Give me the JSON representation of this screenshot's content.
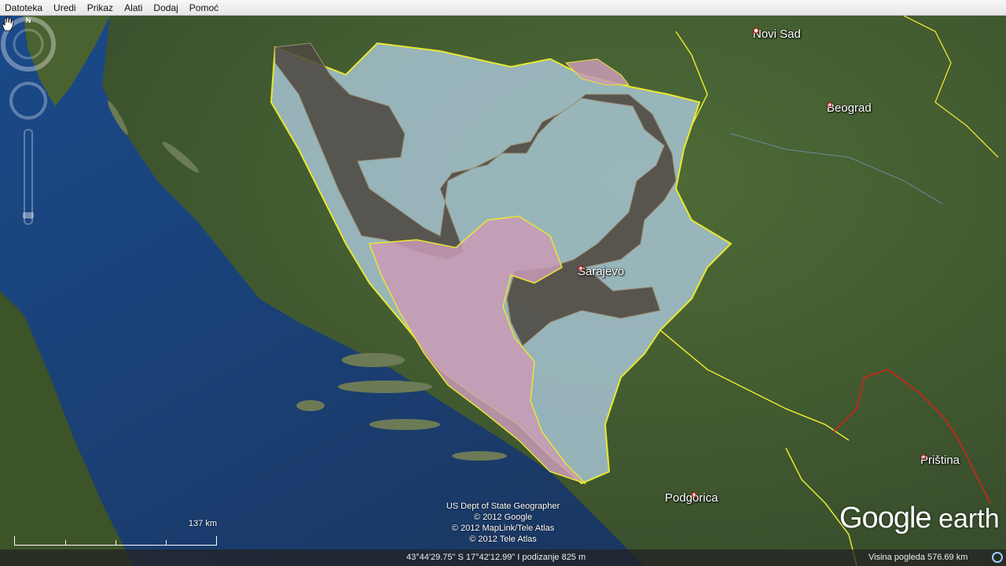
{
  "menu": {
    "items": [
      {
        "label": "Datoteka"
      },
      {
        "label": "Uredi"
      },
      {
        "label": "Prikaz"
      },
      {
        "label": "Alati"
      },
      {
        "label": "Dodaj"
      },
      {
        "label": "Pomoć"
      }
    ]
  },
  "map": {
    "cities": {
      "novi_sad": "Novi Sad",
      "beograd": "Beograd",
      "sarajevo": "Sarajevo",
      "podgorica": "Podgorica",
      "pristina": "Priština"
    },
    "credits": {
      "line1": "US Dept of State Geographer",
      "line2": "© 2012 Google",
      "line3": "© 2012 MapLink/Tele Atlas",
      "line4": "© 2012 Tele Atlas"
    },
    "scale_label": "137 km",
    "compass_label": "N",
    "logo": {
      "google": "Google",
      "earth": "earth"
    },
    "colors": {
      "sea": "#1d3f6e",
      "land": "#3f5a2a",
      "region_blue": "#a9c7d8",
      "region_dark": "#4e4840",
      "region_pink": "#c99bb6",
      "border_yellow": "#e8e830",
      "border_red": "#c8261b"
    }
  },
  "status": {
    "coordinates": "43°44'29.75\" S   17°42'12.99\" I podizanje   825 m",
    "eye_altitude": "Visina pogleda   576.69 km"
  }
}
